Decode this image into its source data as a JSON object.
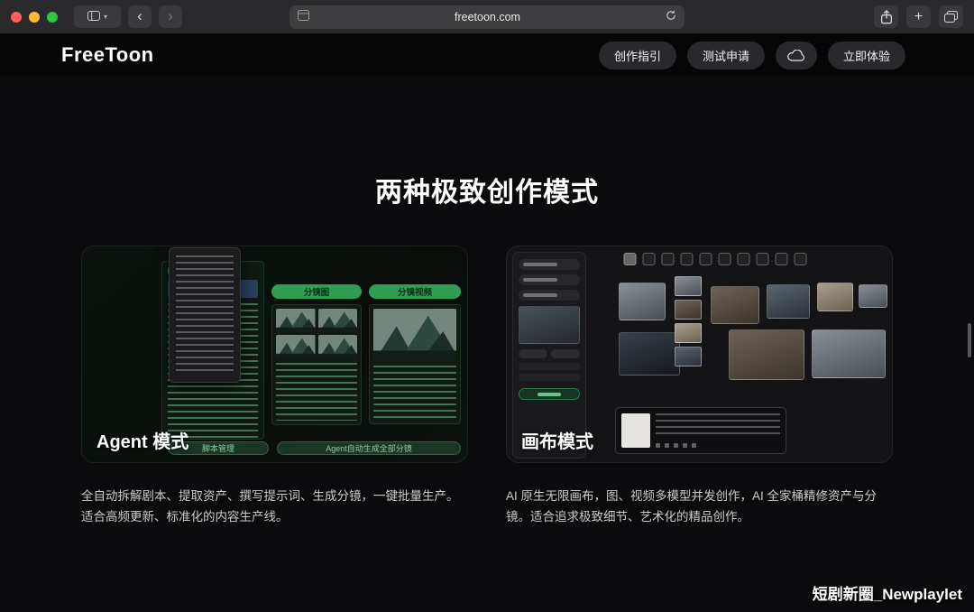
{
  "browser": {
    "url": "freetoon.com"
  },
  "icons": {
    "back": "‹",
    "forward": "›",
    "new_tab": "+",
    "chevron_down": "▾"
  },
  "site_header": {
    "logo": "FreeToon",
    "nav": [
      {
        "label": "创作指引"
      },
      {
        "label": "测试申请"
      },
      {
        "label": "立即体验"
      }
    ]
  },
  "main": {
    "heading": "两种极致创作模式",
    "cards": [
      {
        "label": "Agent 模式",
        "description": "全自动拆解剧本、提取资产、撰写提示词、生成分镜，一键批量生产。适合高频更新、标准化的内容生产线。",
        "mock": {
          "storyboard_button": "分镜图",
          "video_button": "分镜视频",
          "script_button": "脚本管理",
          "agent_button": "Agent自动生成全部分镜"
        }
      },
      {
        "label": "画布模式",
        "description": "AI 原生无限画布，图、视频多模型并发创作，AI 全家桶精修资产与分镜。适合追求极致细节、艺术化的精品创作。"
      }
    ]
  },
  "watermark": "短剧新圈_Newplaylet",
  "colors": {
    "accent_green": "#2f9e52",
    "traffic_red": "#ff5f57",
    "traffic_yellow": "#febc2e",
    "traffic_green": "#28c840"
  }
}
